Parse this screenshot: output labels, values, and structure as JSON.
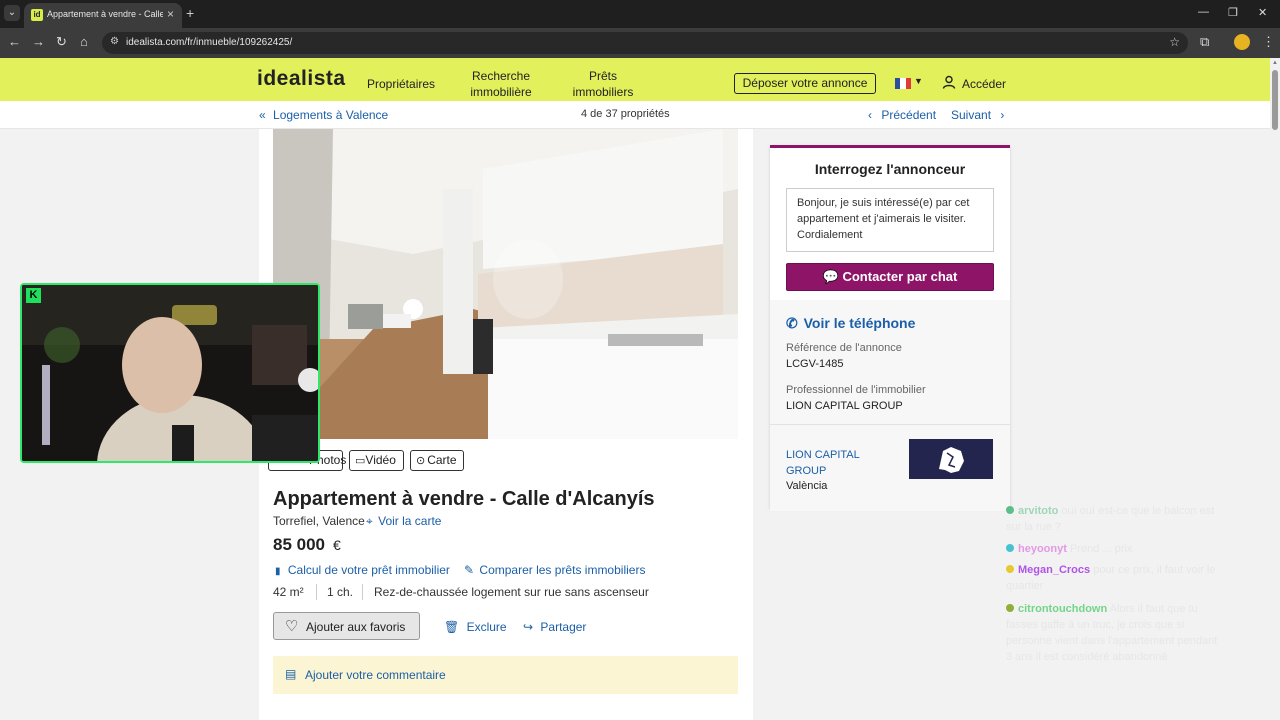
{
  "browser": {
    "tab_title": "Appartement à vendre - Calle d",
    "tab_favicon": "id",
    "url": "idealista.com/fr/inmueble/109262425/"
  },
  "header": {
    "logo": "idealista",
    "nav": [
      "Propriétaires",
      "Recherche\nimmobilière",
      "Prêts\nimmobiliers"
    ],
    "post_button": "Déposer votre annonce",
    "login": "Accéder",
    "bg_color": "#e1f05b"
  },
  "subnav": {
    "back": "Logements à Valence",
    "counter": "4 de 37 propriétés",
    "prev": "Précédent",
    "next": "Suivant"
  },
  "media": {
    "photos": "Photos",
    "video": "Vidéo",
    "map": "Carte"
  },
  "listing": {
    "title": "Appartement à vendre - Calle d'Alcanyís",
    "location": "Torrefiel, Valence",
    "map_link": "Voir la carte",
    "price": "85 000",
    "currency": "€",
    "loan_calc": "Calcul de votre prêt immobilier",
    "compare_loans": "Comparer les prêts immobiliers",
    "area": "42 m²",
    "rooms": "1 ch.",
    "description": "Rez-de-chaussée logement sur rue sans ascenseur",
    "favorite": "Ajouter aux favoris",
    "exclude": "Exclure",
    "share": "Partager",
    "comment": "Ajouter votre commentaire"
  },
  "contact": {
    "title": "Interrogez l'annonceur",
    "message": "Bonjour, je suis intéressé(e) par cet appartement et j'aimerais le visiter. Cordialement",
    "chat_button": "Contacter par chat",
    "phone": "Voir le téléphone",
    "ref_label": "Référence de l'annonce",
    "ref_value": "LCGV-1485",
    "pro_label": "Professionnel de l'immobilier",
    "pro_value": "LION CAPITAL GROUP",
    "agency_link": "LION CAPITAL GROUP",
    "agency_city": "València",
    "accent_color": "#8e1468"
  },
  "stream_chat": [
    {
      "user": "arvitoto",
      "text": "ouí ouí est-ce que le balcon est sur la rue ?",
      "color": "#5bbf8a"
    },
    {
      "user": "heyoonyt",
      "text": "Prend ... prix",
      "color": "#d94fd9"
    },
    {
      "user": "Megan_Crocs",
      "text": "pour ce prix, il faut voir le quartier",
      "color": "#b054e8"
    },
    {
      "user": "citrontouchdown",
      "text": "Alors il faut que tu fasses gaffe à un truc, je crois que si personne vient dans l'appartement pendant 3 ans il est considéré abandonné",
      "color": "#3ec95b"
    }
  ],
  "webcam": {
    "logo": "K"
  }
}
